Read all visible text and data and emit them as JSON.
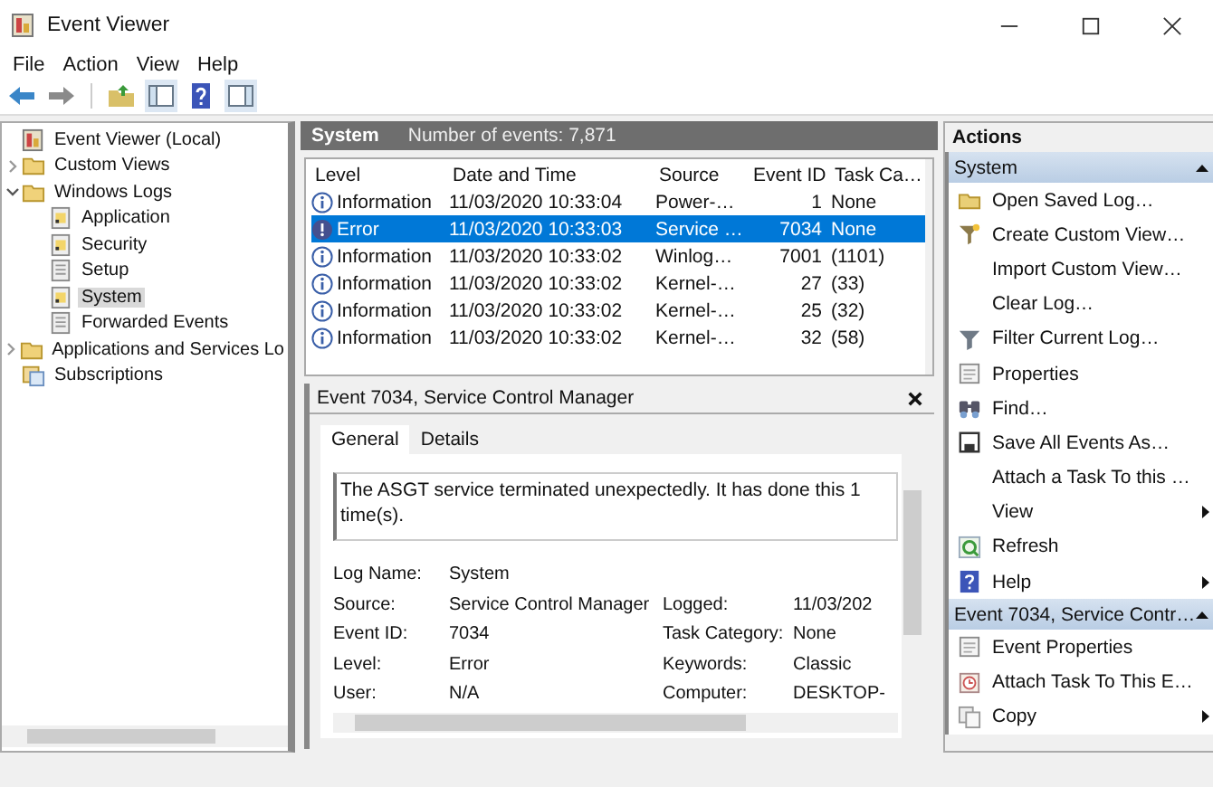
{
  "window": {
    "title": "Event Viewer"
  },
  "menu": [
    "File",
    "Action",
    "View",
    "Help"
  ],
  "tree": [
    {
      "label": "Event Viewer (Local)",
      "kind": "root",
      "selected": false,
      "children": [
        {
          "label": "Custom Views",
          "kind": "folder",
          "expanded": false,
          "selected": false
        },
        {
          "label": "Windows Logs",
          "kind": "folder",
          "expanded": true,
          "selected": false,
          "children": [
            {
              "label": "Application",
              "kind": "log",
              "selected": false
            },
            {
              "label": "Security",
              "kind": "log",
              "selected": false
            },
            {
              "label": "Setup",
              "kind": "plain_log",
              "selected": false
            },
            {
              "label": "System",
              "kind": "log",
              "selected": true
            },
            {
              "label": "Forwarded Events",
              "kind": "plain_log",
              "selected": false
            }
          ]
        },
        {
          "label": "Applications and Services Lo",
          "kind": "folder",
          "expanded": false,
          "selected": false
        },
        {
          "label": "Subscriptions",
          "kind": "subscriptions",
          "selected": false
        }
      ]
    }
  ],
  "log_list": {
    "title": "System",
    "count_label": "Number of events: 7,871",
    "columns": [
      "Level",
      "Date and Time",
      "Source",
      "Event ID",
      "Task Ca…"
    ],
    "rows": [
      {
        "kind": "information",
        "level": "Information",
        "date": "11/03/2020 10:33:04",
        "source": "Power-…",
        "event_id": "1",
        "task_category": "None",
        "selected": false
      },
      {
        "kind": "error",
        "level": "Error",
        "date": "11/03/2020 10:33:03",
        "source": "Service …",
        "event_id": "7034",
        "task_category": "None",
        "selected": true
      },
      {
        "kind": "information",
        "level": "Information",
        "date": "11/03/2020 10:33:02",
        "source": "Winlog…",
        "event_id": "7001",
        "task_category": "(1101)",
        "selected": false
      },
      {
        "kind": "information",
        "level": "Information",
        "date": "11/03/2020 10:33:02",
        "source": "Kernel-…",
        "event_id": "27",
        "task_category": "(33)",
        "selected": false
      },
      {
        "kind": "information",
        "level": "Information",
        "date": "11/03/2020 10:33:02",
        "source": "Kernel-…",
        "event_id": "25",
        "task_category": "(32)",
        "selected": false
      },
      {
        "kind": "information",
        "level": "Information",
        "date": "11/03/2020 10:33:02",
        "source": "Kernel-…",
        "event_id": "32",
        "task_category": "(58)",
        "selected": false
      }
    ]
  },
  "detail": {
    "title": "Event 7034, Service Control Manager",
    "tabs": [
      {
        "label": "General",
        "selected": true
      },
      {
        "label": "Details",
        "selected": false
      }
    ],
    "message": "The ASGT service terminated unexpectedly. It has done this 1 time(s).",
    "rows": [
      {
        "left": {
          "label": "Log Name:",
          "value": "System"
        }
      },
      {
        "left": {
          "label": "Source:",
          "value": "Service Control Manager"
        },
        "right": {
          "label": "Logged:",
          "value": "11/03/202"
        }
      },
      {
        "left": {
          "label": "Event ID:",
          "value": "7034"
        },
        "right": {
          "label": "Task Category:",
          "value": "None"
        }
      },
      {
        "left": {
          "label": "Level:",
          "value": "Error"
        },
        "right": {
          "label": "Keywords:",
          "value": "Classic"
        }
      },
      {
        "left": {
          "label": "User:",
          "value": "N/A"
        },
        "right": {
          "label": "Computer:",
          "value": "DESKTOP-"
        }
      }
    ]
  },
  "actions": {
    "title": "Actions",
    "sections": [
      {
        "title": "System",
        "expanded": true,
        "items": [
          {
            "label": "Open Saved Log…",
            "kind": "folder",
            "submenu": false
          },
          {
            "label": "Create Custom View…",
            "kind": "funnel_new",
            "submenu": false
          },
          {
            "label": "Import Custom View…",
            "kind": "plain",
            "submenu": false
          },
          {
            "label": "Clear Log…",
            "kind": "plain",
            "submenu": false
          },
          {
            "label": "Filter Current Log…",
            "kind": "funnel",
            "submenu": false
          },
          {
            "label": "Properties",
            "kind": "properties",
            "submenu": false
          },
          {
            "label": "Find…",
            "kind": "binoculars",
            "submenu": false
          },
          {
            "label": "Save All Events As…",
            "kind": "save",
            "submenu": false
          },
          {
            "label": "Attach a Task To this …",
            "kind": "plain",
            "submenu": false
          },
          {
            "label": "View",
            "kind": "plain",
            "submenu": true
          },
          {
            "label": "Refresh",
            "kind": "refresh",
            "submenu": false
          },
          {
            "label": "Help",
            "kind": "help",
            "submenu": true
          }
        ]
      },
      {
        "title": "Event 7034, Service Contr…",
        "expanded": true,
        "items": [
          {
            "label": "Event Properties",
            "kind": "properties",
            "submenu": false
          },
          {
            "label": "Attach Task To This E…",
            "kind": "task",
            "submenu": false
          },
          {
            "label": "Copy",
            "kind": "copy",
            "submenu": true
          }
        ]
      }
    ]
  }
}
